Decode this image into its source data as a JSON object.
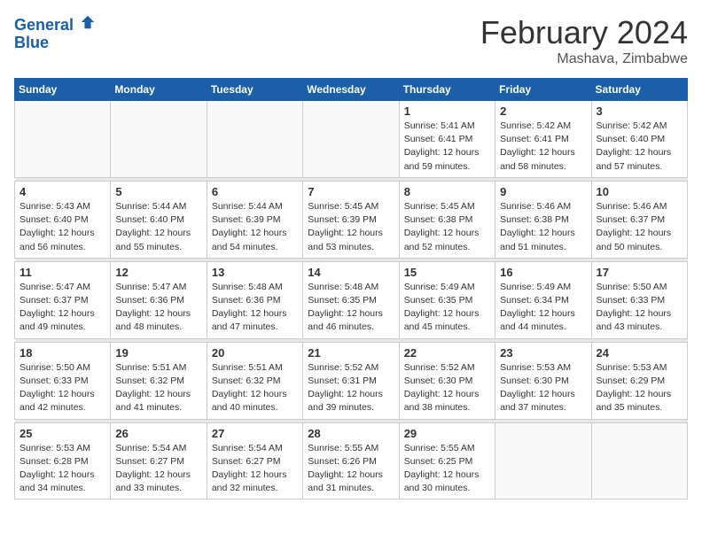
{
  "logo": {
    "line1": "General",
    "line2": "Blue"
  },
  "title": "February 2024",
  "location": "Mashava, Zimbabwe",
  "days_of_week": [
    "Sunday",
    "Monday",
    "Tuesday",
    "Wednesday",
    "Thursday",
    "Friday",
    "Saturday"
  ],
  "weeks": [
    [
      {
        "day": "",
        "info": ""
      },
      {
        "day": "",
        "info": ""
      },
      {
        "day": "",
        "info": ""
      },
      {
        "day": "",
        "info": ""
      },
      {
        "day": "1",
        "info": "Sunrise: 5:41 AM\nSunset: 6:41 PM\nDaylight: 12 hours\nand 59 minutes."
      },
      {
        "day": "2",
        "info": "Sunrise: 5:42 AM\nSunset: 6:41 PM\nDaylight: 12 hours\nand 58 minutes."
      },
      {
        "day": "3",
        "info": "Sunrise: 5:42 AM\nSunset: 6:40 PM\nDaylight: 12 hours\nand 57 minutes."
      }
    ],
    [
      {
        "day": "4",
        "info": "Sunrise: 5:43 AM\nSunset: 6:40 PM\nDaylight: 12 hours\nand 56 minutes."
      },
      {
        "day": "5",
        "info": "Sunrise: 5:44 AM\nSunset: 6:40 PM\nDaylight: 12 hours\nand 55 minutes."
      },
      {
        "day": "6",
        "info": "Sunrise: 5:44 AM\nSunset: 6:39 PM\nDaylight: 12 hours\nand 54 minutes."
      },
      {
        "day": "7",
        "info": "Sunrise: 5:45 AM\nSunset: 6:39 PM\nDaylight: 12 hours\nand 53 minutes."
      },
      {
        "day": "8",
        "info": "Sunrise: 5:45 AM\nSunset: 6:38 PM\nDaylight: 12 hours\nand 52 minutes."
      },
      {
        "day": "9",
        "info": "Sunrise: 5:46 AM\nSunset: 6:38 PM\nDaylight: 12 hours\nand 51 minutes."
      },
      {
        "day": "10",
        "info": "Sunrise: 5:46 AM\nSunset: 6:37 PM\nDaylight: 12 hours\nand 50 minutes."
      }
    ],
    [
      {
        "day": "11",
        "info": "Sunrise: 5:47 AM\nSunset: 6:37 PM\nDaylight: 12 hours\nand 49 minutes."
      },
      {
        "day": "12",
        "info": "Sunrise: 5:47 AM\nSunset: 6:36 PM\nDaylight: 12 hours\nand 48 minutes."
      },
      {
        "day": "13",
        "info": "Sunrise: 5:48 AM\nSunset: 6:36 PM\nDaylight: 12 hours\nand 47 minutes."
      },
      {
        "day": "14",
        "info": "Sunrise: 5:48 AM\nSunset: 6:35 PM\nDaylight: 12 hours\nand 46 minutes."
      },
      {
        "day": "15",
        "info": "Sunrise: 5:49 AM\nSunset: 6:35 PM\nDaylight: 12 hours\nand 45 minutes."
      },
      {
        "day": "16",
        "info": "Sunrise: 5:49 AM\nSunset: 6:34 PM\nDaylight: 12 hours\nand 44 minutes."
      },
      {
        "day": "17",
        "info": "Sunrise: 5:50 AM\nSunset: 6:33 PM\nDaylight: 12 hours\nand 43 minutes."
      }
    ],
    [
      {
        "day": "18",
        "info": "Sunrise: 5:50 AM\nSunset: 6:33 PM\nDaylight: 12 hours\nand 42 minutes."
      },
      {
        "day": "19",
        "info": "Sunrise: 5:51 AM\nSunset: 6:32 PM\nDaylight: 12 hours\nand 41 minutes."
      },
      {
        "day": "20",
        "info": "Sunrise: 5:51 AM\nSunset: 6:32 PM\nDaylight: 12 hours\nand 40 minutes."
      },
      {
        "day": "21",
        "info": "Sunrise: 5:52 AM\nSunset: 6:31 PM\nDaylight: 12 hours\nand 39 minutes."
      },
      {
        "day": "22",
        "info": "Sunrise: 5:52 AM\nSunset: 6:30 PM\nDaylight: 12 hours\nand 38 minutes."
      },
      {
        "day": "23",
        "info": "Sunrise: 5:53 AM\nSunset: 6:30 PM\nDaylight: 12 hours\nand 37 minutes."
      },
      {
        "day": "24",
        "info": "Sunrise: 5:53 AM\nSunset: 6:29 PM\nDaylight: 12 hours\nand 35 minutes."
      }
    ],
    [
      {
        "day": "25",
        "info": "Sunrise: 5:53 AM\nSunset: 6:28 PM\nDaylight: 12 hours\nand 34 minutes."
      },
      {
        "day": "26",
        "info": "Sunrise: 5:54 AM\nSunset: 6:27 PM\nDaylight: 12 hours\nand 33 minutes."
      },
      {
        "day": "27",
        "info": "Sunrise: 5:54 AM\nSunset: 6:27 PM\nDaylight: 12 hours\nand 32 minutes."
      },
      {
        "day": "28",
        "info": "Sunrise: 5:55 AM\nSunset: 6:26 PM\nDaylight: 12 hours\nand 31 minutes."
      },
      {
        "day": "29",
        "info": "Sunrise: 5:55 AM\nSunset: 6:25 PM\nDaylight: 12 hours\nand 30 minutes."
      },
      {
        "day": "",
        "info": ""
      },
      {
        "day": "",
        "info": ""
      }
    ]
  ]
}
